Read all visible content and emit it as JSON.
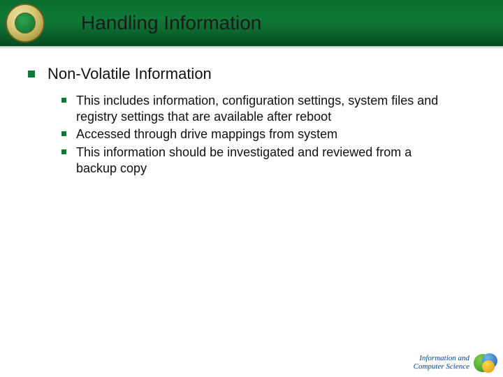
{
  "slide": {
    "title": "Handling Information",
    "main_bullet": "Non-Volatile Information",
    "sub_bullets": [
      "This includes information, configuration settings, system files and registry settings that are available after reboot",
      "Accessed through drive mappings from system",
      "This information should be investigated and reviewed from a backup copy"
    ]
  },
  "footer": {
    "line1": "Information and",
    "line2": "Computer Science"
  }
}
